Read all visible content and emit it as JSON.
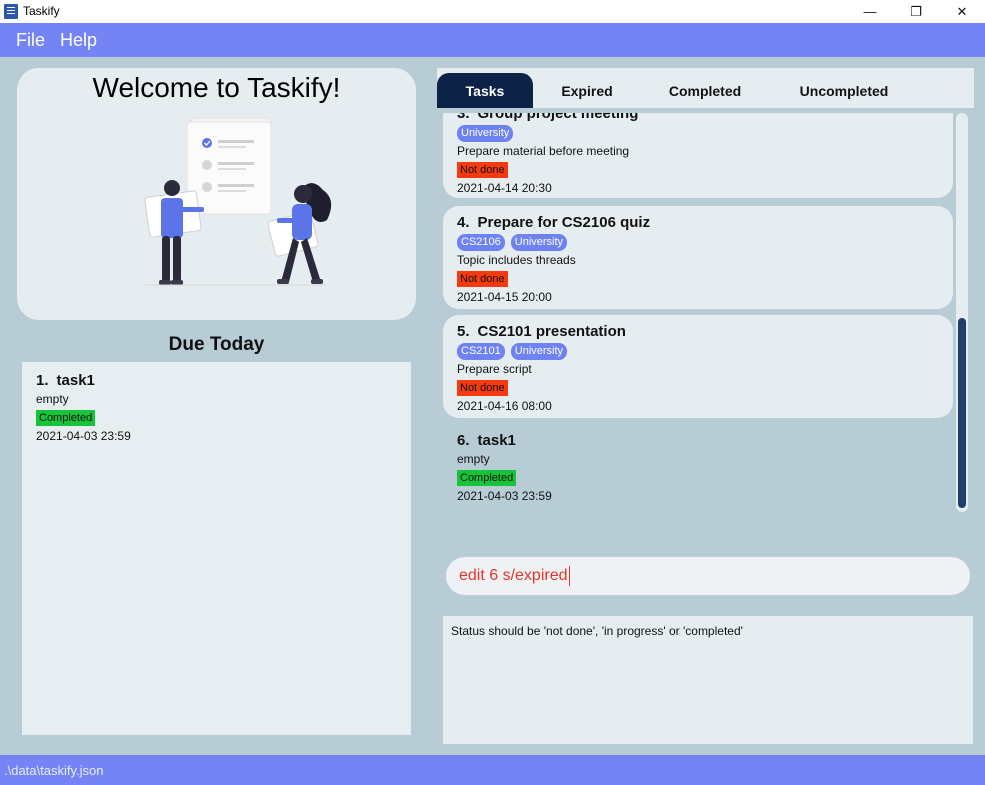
{
  "window": {
    "title": "Taskify",
    "minimize_icon": "—",
    "restore_icon": "❐",
    "close_icon": "✕"
  },
  "menu": {
    "items": [
      "File",
      "Help"
    ]
  },
  "welcome": {
    "title": "Welcome to Taskify!"
  },
  "due_today": {
    "title": "Due Today",
    "tasks": [
      {
        "index": "1.",
        "name": "task1",
        "description": "empty",
        "status": "Completed",
        "date": "2021-04-03 23:59"
      }
    ]
  },
  "tabs": [
    {
      "label": "Tasks",
      "active": true
    },
    {
      "label": "Expired",
      "active": false
    },
    {
      "label": "Completed",
      "active": false
    },
    {
      "label": "Uncompleted",
      "active": false
    }
  ],
  "task_list": [
    {
      "index": "3.",
      "name": "Group project meeting",
      "tags": [
        "University"
      ],
      "description": "Prepare material before meeting",
      "status": "Not done",
      "date": "2021-04-14 20:30"
    },
    {
      "index": "4.",
      "name": "Prepare for CS2106 quiz",
      "tags": [
        "CS2106",
        "University"
      ],
      "description": "Topic includes threads",
      "status": "Not done",
      "date": "2021-04-15 20:00"
    },
    {
      "index": "5.",
      "name": "CS2101 presentation",
      "tags": [
        "CS2101",
        "University"
      ],
      "description": "Prepare script",
      "status": "Not done",
      "date": "2021-04-16 08:00"
    },
    {
      "index": "6.",
      "name": "task1",
      "tags": [],
      "description": "empty",
      "status": "Completed",
      "date": "2021-04-03 23:59",
      "selected": true
    }
  ],
  "command": {
    "value": "edit 6 s/expired"
  },
  "result": {
    "message": "Status should be 'not done', 'in progress' or 'completed'"
  },
  "status_bar": {
    "path": ".\\data\\taskify.json"
  },
  "colors": {
    "accent": "#7484f5",
    "active_tab": "#0c2247",
    "tag": "#6f82f1",
    "not_done": "#f53a10",
    "completed": "#16c43a",
    "command_text": "#e5362a"
  }
}
